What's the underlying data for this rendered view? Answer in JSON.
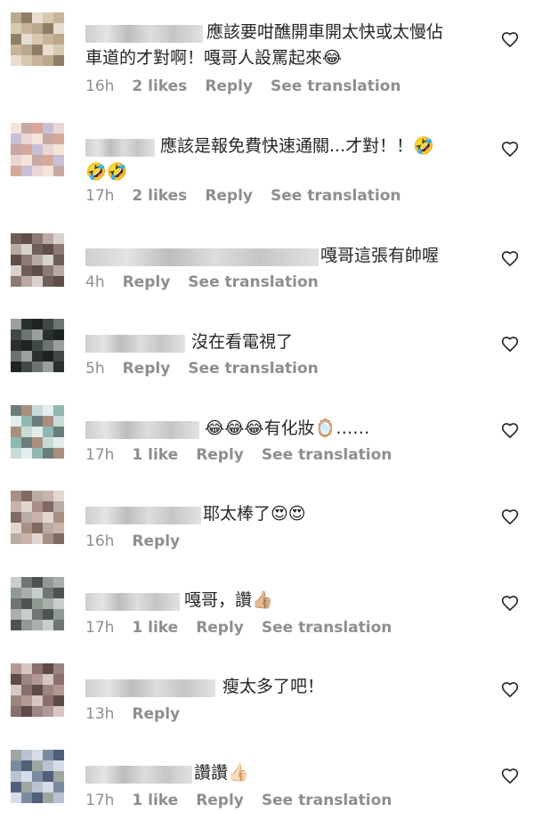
{
  "comments": [
    {
      "line1": "應該要咁醮開車開太快或太慢佔",
      "line2": "車道的才對啊！嘎哥人設罵起來😂",
      "time": "16h",
      "likes": "2 likes",
      "reply": "Reply",
      "translate": "See translation"
    },
    {
      "line1": "應該是報免費快速通關...才對！！🤣",
      "line2": "🤣🤣",
      "time": "17h",
      "likes": "2 likes",
      "reply": "Reply",
      "translate": "See translation"
    },
    {
      "line1": "嘎哥這張有帥喔",
      "time": "4h",
      "reply": "Reply",
      "translate": "See translation"
    },
    {
      "line1": "沒在看電視了",
      "time": "5h",
      "reply": "Reply",
      "translate": "See translation"
    },
    {
      "line1": "😂😂😂有化妝🪞……",
      "time": "17h",
      "likes": "1 like",
      "reply": "Reply",
      "translate": "See translation"
    },
    {
      "line1": "耶太棒了😍😍",
      "time": "16h",
      "reply": "Reply"
    },
    {
      "line1": "嘎哥，讚👍🏼",
      "time": "17h",
      "likes": "1 like",
      "reply": "Reply",
      "translate": "See translation"
    },
    {
      "line1": "瘦太多了吧！",
      "time": "13h",
      "reply": "Reply"
    },
    {
      "line1": "讚讚👍🏻",
      "time": "17h",
      "likes": "1 like",
      "reply": "Reply",
      "translate": "See translation"
    }
  ]
}
